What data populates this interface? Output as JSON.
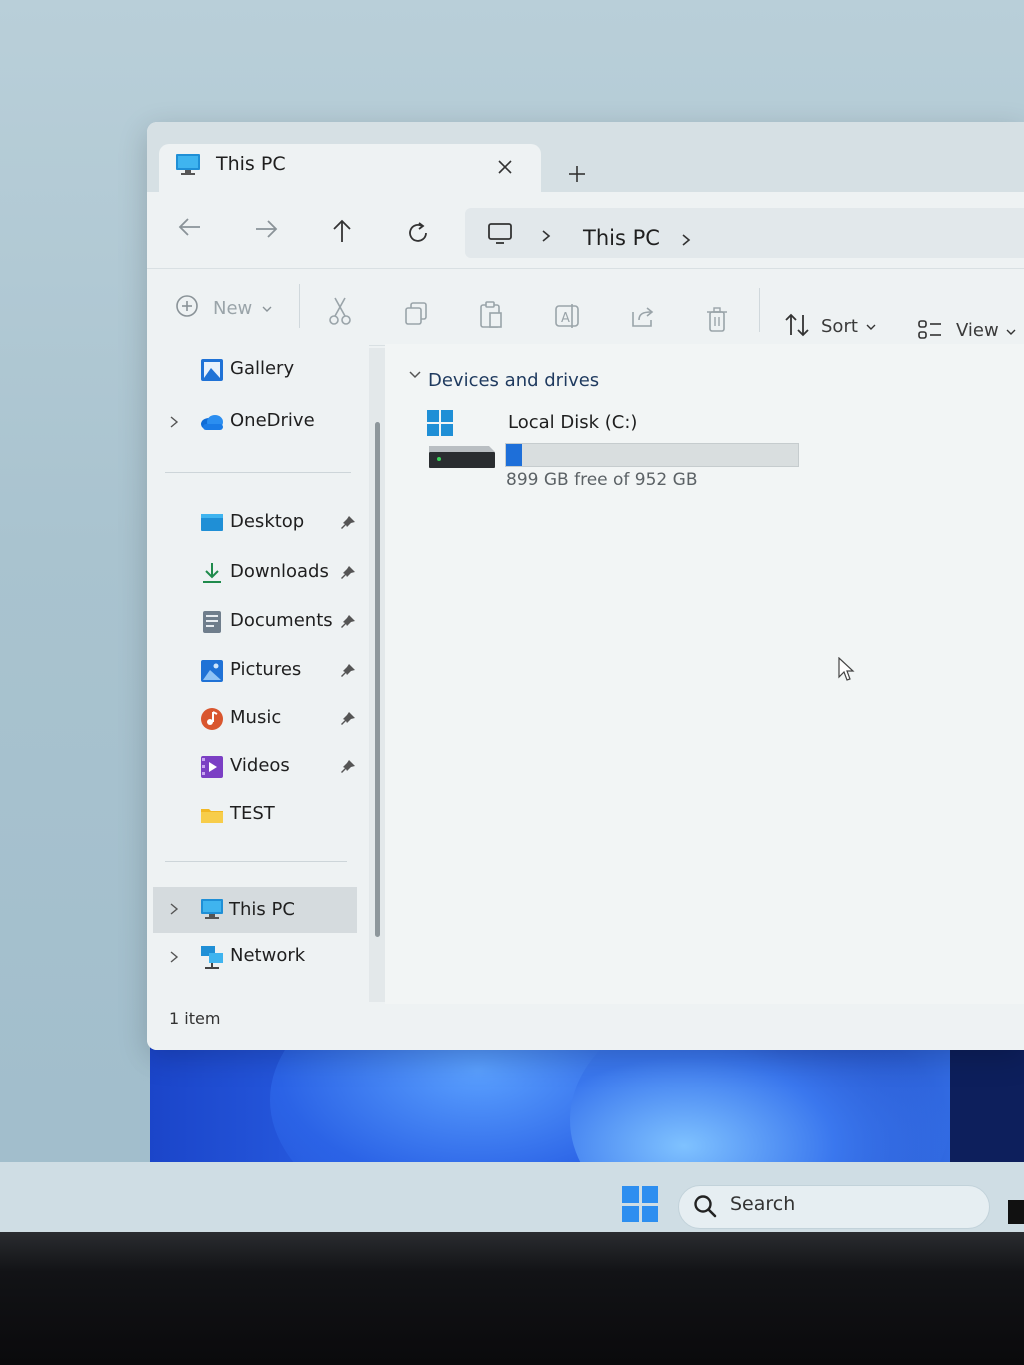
{
  "window": {
    "tab_title": "This PC",
    "tab_icon": "monitor-icon",
    "new_tab_glyph": "+",
    "close_tab_glyph": "×"
  },
  "address_bar": {
    "location": "This PC",
    "icon": "monitor-outline-icon"
  },
  "toolbar": {
    "new_label": "New",
    "sort_label": "Sort",
    "view_label": "View",
    "actions": [
      "cut-icon",
      "copy-icon",
      "paste-icon",
      "rename-icon",
      "share-icon",
      "delete-icon"
    ]
  },
  "navigation": {
    "top_items": [
      {
        "label": "Gallery",
        "icon": "gallery-icon",
        "expandable": false
      },
      {
        "label": "OneDrive",
        "icon": "onedrive-cloud-icon",
        "expandable": true
      }
    ],
    "quick_access": [
      {
        "label": "Desktop",
        "icon": "desktop-folder-icon",
        "pinned": true
      },
      {
        "label": "Downloads",
        "icon": "download-arrow-icon",
        "pinned": true
      },
      {
        "label": "Documents",
        "icon": "documents-icon",
        "pinned": true
      },
      {
        "label": "Pictures",
        "icon": "pictures-icon",
        "pinned": true
      },
      {
        "label": "Music",
        "icon": "music-icon",
        "pinned": true
      },
      {
        "label": "Videos",
        "icon": "videos-icon",
        "pinned": true
      },
      {
        "label": "TEST",
        "icon": "yellow-folder-icon",
        "pinned": false
      }
    ],
    "bottom_items": [
      {
        "label": "This PC",
        "icon": "monitor-icon",
        "selected": true
      },
      {
        "label": "Network",
        "icon": "network-icon",
        "selected": false
      }
    ]
  },
  "content": {
    "group_title": "Devices and drives",
    "drives": [
      {
        "name": "Local Disk (C:)",
        "free_text": "899 GB free of 952 GB",
        "used_fraction": 0.056,
        "bar_color": "#1e6fd9"
      }
    ]
  },
  "status": {
    "item_count": "1 item"
  },
  "taskbar": {
    "search_label": "Search",
    "start_color": "#2d8ef0"
  }
}
